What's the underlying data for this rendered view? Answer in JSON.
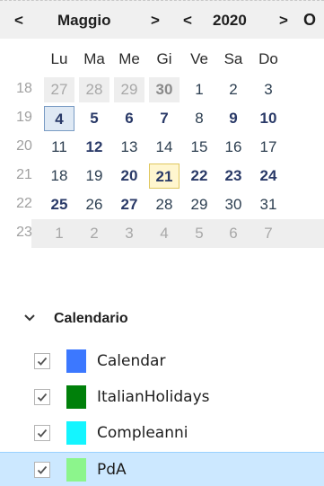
{
  "header": {
    "prev_month": "<",
    "month": "Maggio",
    "next_month": ">",
    "prev_year": "<",
    "year": "2020",
    "next_year": ">",
    "overflow": "O"
  },
  "weekdays": [
    "Lu",
    "Ma",
    "Me",
    "Gi",
    "Ve",
    "Sa",
    "Do"
  ],
  "weeks": [
    {
      "num": "18",
      "days": [
        {
          "d": "27",
          "other": true
        },
        {
          "d": "28",
          "other": true
        },
        {
          "d": "29",
          "other": true
        },
        {
          "d": "30",
          "other": true,
          "bold": true
        },
        {
          "d": "1"
        },
        {
          "d": "2"
        },
        {
          "d": "3"
        }
      ]
    },
    {
      "num": "19",
      "days": [
        {
          "d": "4",
          "bold": true,
          "selected": true
        },
        {
          "d": "5",
          "bold": true
        },
        {
          "d": "6",
          "bold": true
        },
        {
          "d": "7",
          "bold": true
        },
        {
          "d": "8"
        },
        {
          "d": "9",
          "bold": true
        },
        {
          "d": "10",
          "bold": true
        }
      ]
    },
    {
      "num": "20",
      "days": [
        {
          "d": "11"
        },
        {
          "d": "12",
          "bold": true
        },
        {
          "d": "13"
        },
        {
          "d": "14"
        },
        {
          "d": "15"
        },
        {
          "d": "16"
        },
        {
          "d": "17"
        }
      ]
    },
    {
      "num": "21",
      "days": [
        {
          "d": "18"
        },
        {
          "d": "19"
        },
        {
          "d": "20",
          "bold": true
        },
        {
          "d": "21",
          "bold": true,
          "today": true
        },
        {
          "d": "22",
          "bold": true
        },
        {
          "d": "23",
          "bold": true
        },
        {
          "d": "24",
          "bold": true
        }
      ]
    },
    {
      "num": "22",
      "days": [
        {
          "d": "25",
          "bold": true
        },
        {
          "d": "26"
        },
        {
          "d": "27",
          "bold": true
        },
        {
          "d": "28"
        },
        {
          "d": "29"
        },
        {
          "d": "30"
        },
        {
          "d": "31"
        }
      ]
    },
    {
      "num": "23",
      "days": [
        {
          "d": "1",
          "other": true
        },
        {
          "d": "2",
          "other": true
        },
        {
          "d": "3",
          "other": true
        },
        {
          "d": "4",
          "other": true
        },
        {
          "d": "5",
          "other": true
        },
        {
          "d": "6",
          "other": true
        },
        {
          "d": "7",
          "other": true
        }
      ]
    }
  ],
  "calendars_section": {
    "title": "Calendario",
    "items": [
      {
        "name": "Calendar",
        "color": "#3c78ff",
        "checked": true
      },
      {
        "name": "ItalianHolidays",
        "color": "#00800a",
        "checked": true
      },
      {
        "name": "Compleanni",
        "color": "#14f5ff",
        "checked": true
      },
      {
        "name": "PdA",
        "color": "#8cf58c",
        "checked": true,
        "selected": true
      }
    ]
  }
}
